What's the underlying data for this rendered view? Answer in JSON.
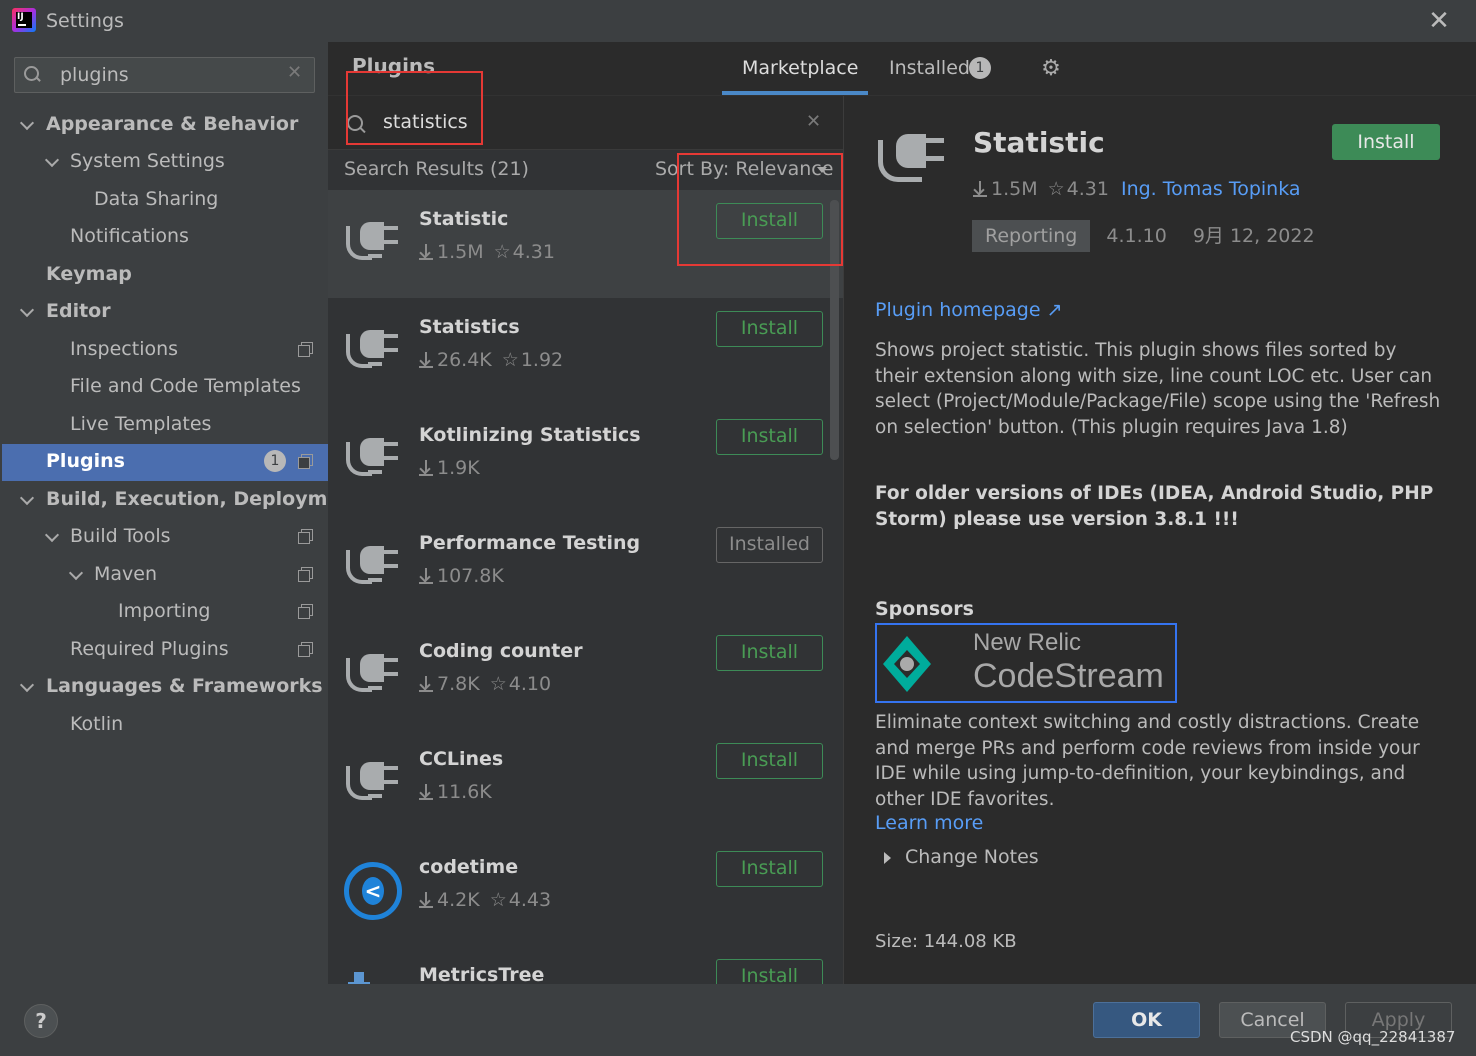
{
  "window": {
    "title": "Settings",
    "close_icon": "close-icon"
  },
  "sidebar": {
    "search_value": "plugins",
    "items": [
      {
        "label": "Appearance & Behavior"
      },
      {
        "label": "System Settings"
      },
      {
        "label": "Data Sharing"
      },
      {
        "label": "Notifications"
      },
      {
        "label": "Keymap"
      },
      {
        "label": "Editor"
      },
      {
        "label": "Inspections"
      },
      {
        "label": "File and Code Templates"
      },
      {
        "label": "Live Templates"
      },
      {
        "label": "Plugins",
        "badge": "1"
      },
      {
        "label": "Build, Execution, Deployment"
      },
      {
        "label": "Build Tools"
      },
      {
        "label": "Maven"
      },
      {
        "label": "Importing"
      },
      {
        "label": "Required Plugins"
      },
      {
        "label": "Languages & Frameworks"
      },
      {
        "label": "Kotlin"
      }
    ]
  },
  "header": {
    "title": "Plugins",
    "tabs": [
      {
        "label": "Marketplace"
      },
      {
        "label": "Installed",
        "badge": "1"
      }
    ]
  },
  "list": {
    "search_value": "statistics",
    "results_label": "Search Results (21)",
    "sort_label": "Sort By: Relevance",
    "plugins": [
      {
        "name": "Statistic",
        "downloads": "1.5M",
        "rating": "4.31",
        "button": "Install"
      },
      {
        "name": "Statistics",
        "downloads": "26.4K",
        "rating": "1.92",
        "button": "Install"
      },
      {
        "name": "Kotlinizing Statistics",
        "downloads": "1.9K",
        "rating": "",
        "button": "Install"
      },
      {
        "name": "Performance Testing",
        "downloads": "107.8K",
        "rating": "",
        "button": "Installed"
      },
      {
        "name": "Coding counter",
        "downloads": "7.8K",
        "rating": "4.10",
        "button": "Install"
      },
      {
        "name": "CCLines",
        "downloads": "11.6K",
        "rating": "",
        "button": "Install"
      },
      {
        "name": "codetime",
        "downloads": "4.2K",
        "rating": "4.43",
        "button": "Install"
      },
      {
        "name": "MetricsTree",
        "downloads": "",
        "rating": "",
        "button": "Install"
      }
    ]
  },
  "detail": {
    "name": "Statistic",
    "install_label": "Install",
    "downloads": "1.5M",
    "rating": "4.31",
    "author": "Ing. Tomas Topinka",
    "tag": "Reporting",
    "version": "4.1.10",
    "date": "9月 12, 2022",
    "homepage_label": "Plugin homepage ↗",
    "description": "Shows project statistic. This plugin shows files sorted by their extension along with size, line count LOC etc. User can select (Project/Module/Package/File) scope using the 'Refresh on selection' button. (This plugin requires Java 1.8)",
    "warning": "For older versions of IDEs (IDEA, Android Studio, PHP Storm) please use version 3.8.1 !!!",
    "sponsors_label": "Sponsors",
    "sponsor_line1": "New Relic",
    "sponsor_line2": "CodeStream",
    "sponsor_desc": "Eliminate context switching and costly distractions. Create and merge PRs and perform code reviews from inside your IDE while using jump-to-definition, your keybindings, and other IDE favorites.",
    "learn_more": "Learn more",
    "change_notes": "Change Notes",
    "size": "Size: 144.08 KB"
  },
  "footer": {
    "help": "?",
    "ok": "OK",
    "cancel": "Cancel",
    "apply": "Apply",
    "watermark": "CSDN @qq_22841387"
  },
  "colors": {
    "accent_selection": "#4b6eaf",
    "install_green": "#499c54",
    "link_blue": "#589df6",
    "annotation_red": "#e53935"
  }
}
